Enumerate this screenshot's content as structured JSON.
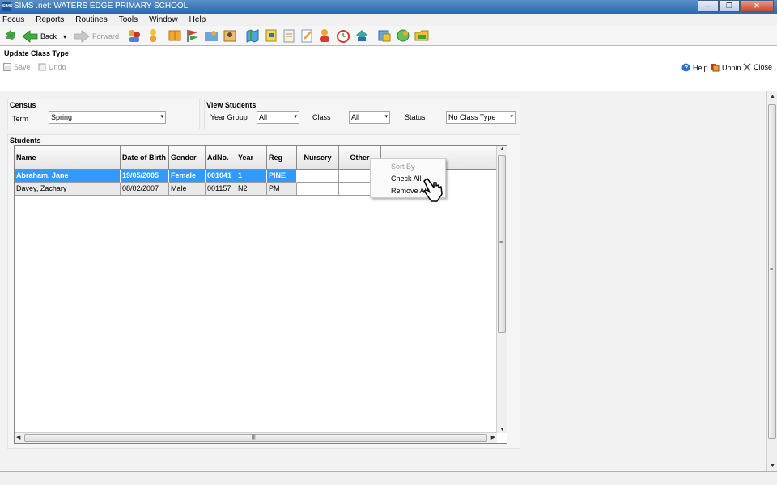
{
  "window": {
    "app_icon_label": "SIMS",
    "title": "SIMS .net: WATERS EDGE PRIMARY SCHOOL",
    "minimize": "–",
    "maximize": "❐",
    "close": "✕"
  },
  "menu": [
    "Focus",
    "Reports",
    "Routines",
    "Tools",
    "Window",
    "Help"
  ],
  "toolbar": {
    "back_label": "Back",
    "forward_label": "Forward",
    "dropdown_glyph": "▾"
  },
  "panel": {
    "title": "Update Class Type",
    "save_label": "Save",
    "undo_label": "Undo",
    "help_label": "Help",
    "unpin_label": "Unpin",
    "close_label": "Close"
  },
  "census": {
    "title": "Census",
    "term_label": "Term",
    "term_value": "Spring"
  },
  "view_students": {
    "title": "View Students",
    "year_group_label": "Year Group",
    "year_group_value": "All",
    "class_label": "Class",
    "class_value": "All",
    "status_label": "Status",
    "status_value": "No Class Type"
  },
  "students": {
    "title": "Students",
    "columns": [
      "Name",
      "Date of Birth",
      "Gender",
      "AdNo.",
      "Year",
      "Reg",
      "Nursery",
      "Other"
    ],
    "rows": [
      {
        "name": "Abraham, Jane",
        "dob": "19/05/2005",
        "gender": "Female",
        "adno": "001041",
        "year": "1",
        "reg": "PINE",
        "nursery": "",
        "other": ""
      },
      {
        "name": "Davey, Zachary",
        "dob": "08/02/2007",
        "gender": "Male",
        "adno": "001157",
        "year": "N2",
        "reg": "PM",
        "nursery": "",
        "other": ""
      }
    ]
  },
  "context_menu": {
    "sort_by": "Sort By",
    "check_all": "Check All",
    "remove_all": "Remove All"
  },
  "scroll": {
    "up": "▲",
    "down": "▼",
    "left": "◀",
    "right": "▶",
    "grip": "≡",
    "hgrip": "|||"
  },
  "colors": {
    "selection": "#3399ff",
    "titlebar": "#2e66a8"
  }
}
